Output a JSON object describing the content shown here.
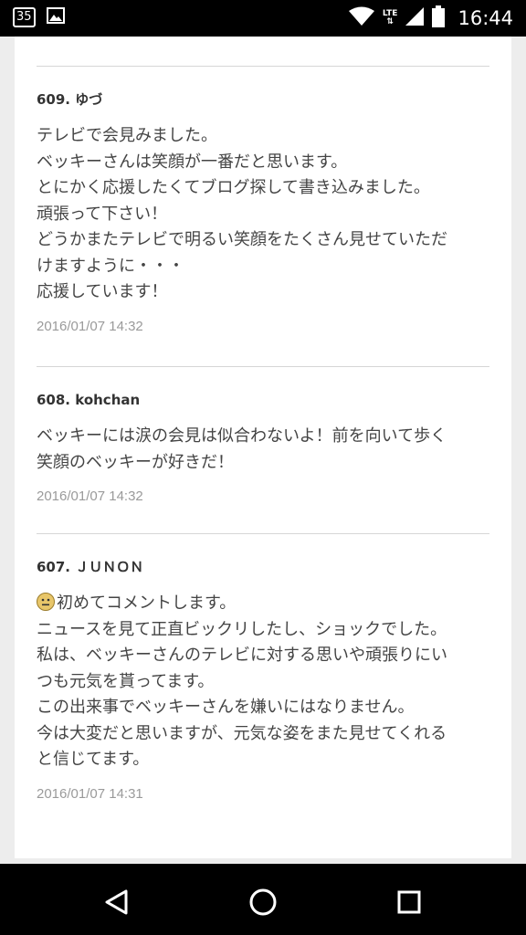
{
  "status_bar": {
    "notification_badge": "35",
    "network": "LTE",
    "time": "16:44"
  },
  "comments": [
    {
      "number": "609.",
      "author": "ゆづ",
      "lines": [
        "テレビで会見みました。",
        "ベッキーさんは笑顔が一番だと思います。",
        "とにかく応援したくてブログ探して書き込みました。",
        "頑張って下さい！",
        "どうかまたテレビで明るい笑顔をたくさん見せていただ",
        "けますように・・・",
        "応援しています！"
      ],
      "date": "2016/01/07 14:32"
    },
    {
      "number": "608.",
      "author": "kohchan",
      "lines": [
        "ベッキーには涙の会見は似合わないよ！前を向いて歩く",
        "笑顔のベッキーが好きだ！"
      ],
      "date": "2016/01/07 14:32"
    },
    {
      "number": "607.",
      "author": "ＪＵＮＯＮ",
      "lines": [
        "初めてコメントします。",
        "ニュースを見て正直ビックリしたし、ショックでした。",
        "私は、ベッキーさんのテレビに対する思いや頑張りにい",
        "つも元気を貰ってます。",
        "この出来事でベッキーさんを嫌いにはなりません。",
        "今は大変だと思いますが、元気な姿をまた見せてくれる",
        "と信じてます。"
      ],
      "date": "2016/01/07 14:31"
    }
  ],
  "navigation": {
    "back_icon": "back-triangle-icon",
    "home_icon": "home-circle-icon",
    "recents_icon": "recents-square-icon"
  }
}
